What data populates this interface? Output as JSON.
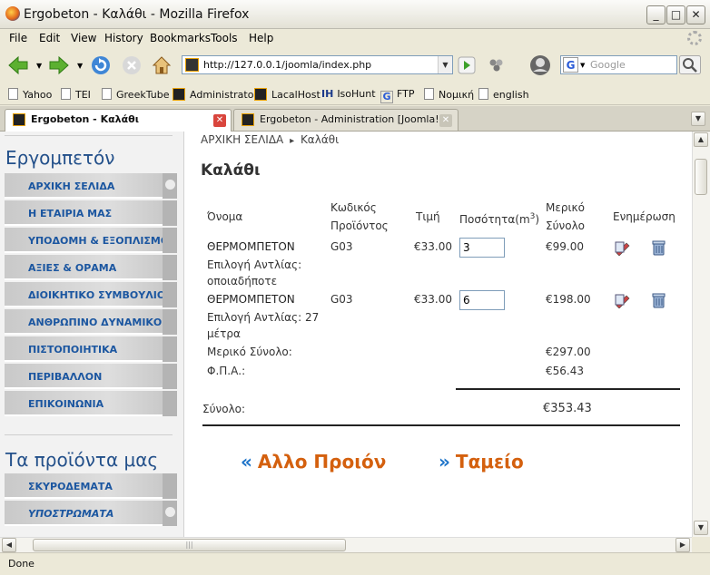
{
  "window": {
    "title": "Ergobeton - Καλάθι - Mozilla Firefox"
  },
  "menu": [
    "File",
    "Edit",
    "View",
    "History",
    "Bookmarks",
    "Tools",
    "Help"
  ],
  "nav": {
    "url": "http://127.0.0.1/joomla/index.php",
    "search_placeholder": "Google",
    "search_engine_icon": "G"
  },
  "bookmarks": [
    "Yahoo",
    "TEI",
    "GreekTube",
    "Administrator",
    "LacalHost",
    "IsoHunt",
    "FTP",
    "Νομική",
    "english"
  ],
  "tabs": [
    {
      "label": "Ergobeton - Καλάθι",
      "active": true
    },
    {
      "label": "Ergobeton - Administration [Joomla!]",
      "active": false
    }
  ],
  "sidebar": {
    "heading1": "Εργομπετόν",
    "items1": [
      "ΑΡΧΙΚΗ ΣΕΛΙΔΑ",
      "Η ΕΤΑΙΡΙΑ ΜΑΣ",
      "ΥΠΟΔΟΜΗ & ΕΞΟΠΛΙΣΜΟΣ",
      "ΑΞΙΕΣ & ΟΡΑΜΑ",
      "ΔΙΟΙΚΗΤΙΚΟ ΣΥΜΒΟΥΛΙΟ",
      "ΑΝΘΡΩΠΙΝΟ ΔΥΝΑΜΙΚΟ",
      "ΠΙΣΤΟΠΟΙΗΤΙΚΑ",
      "ΠΕΡΙΒΑΛΛΟΝ",
      "ΕΠΙΚΟΙΝΩΝΙΑ"
    ],
    "heading2": "Τα προϊόντα μας",
    "items2": [
      "ΣΚΥΡΟΔΕΜΑΤΑ",
      "ΥΠΟΣΤΡΩΜΑΤΑ"
    ]
  },
  "main": {
    "breadcrumb_home": "ΑΡΧΙΚΗ ΣΕΛΙΔΑ",
    "breadcrumb_sep": "▸",
    "breadcrumb_current": "Καλάθι",
    "title": "Καλάθι",
    "headers": {
      "name": "Όνομα",
      "code_line1": "Κωδικός",
      "code_line2": "Προϊόντος",
      "price": "Τιμή",
      "qty": "Ποσότητα(m",
      "qty_sup": "3",
      "qty_close": ")",
      "subtotal_line1": "Μερικό",
      "subtotal_line2": "Σύνολο",
      "update": "Ενημέρωση"
    },
    "rows": [
      {
        "name": "ΘΕΡΜΟΜΠΕΤΟΝ",
        "option_line1": "Επιλογή Αντλίας:",
        "option_line2": "οποιαδήποτε",
        "code": "G03",
        "price": "€33.00",
        "qty": "3",
        "subtotal": "€99.00"
      },
      {
        "name": "ΘΕΡΜΟΜΠΕΤΟΝ",
        "option_line1": "Επιλογή Αντλίας: 27",
        "option_line2": "μέτρα",
        "code": "G03",
        "price": "€33.00",
        "qty": "6",
        "subtotal": "€198.00"
      }
    ],
    "subtotal_label": "Μερικό Σύνολο:",
    "subtotal_value": "€297.00",
    "vat_label": "Φ.Π.Α.:",
    "vat_value": "€56.43",
    "total_label": "Σύνολο:",
    "total_value": "€353.43",
    "other_product": "Αλλο Προιόν",
    "checkout": "Ταμείο",
    "arrow_glyph": "«",
    "arrow_glyph2": "»"
  },
  "status": "Done"
}
